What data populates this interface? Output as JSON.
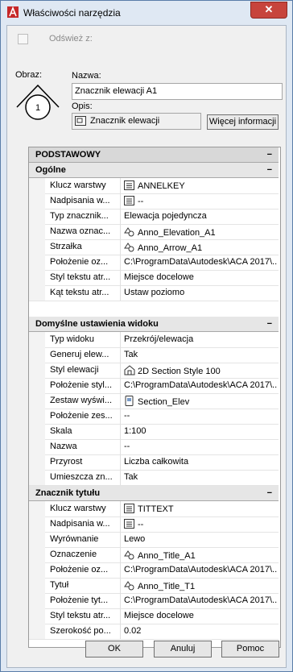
{
  "window": {
    "title": "Właściwości narzędzia",
    "close_glyph": "✕"
  },
  "top": {
    "refresh_label": "Odśwież z:",
    "image_label": "Obraz:",
    "name_label": "Nazwa:",
    "name_value": "Znacznik elewacji A1",
    "desc_label": "Opis:",
    "desc_value": "Znacznik elewacji",
    "more_button": "Więcej informacji",
    "symbol_number": "1"
  },
  "sections": {
    "basic": "PODSTAWOWY",
    "general": "Ogólne",
    "view_defaults": "Domyślne ustawienia widoku",
    "title_mark": "Znacznik tytułu",
    "collapse_glyph": "−"
  },
  "general_rows": [
    {
      "label": "Klucz warstwy",
      "value": "ANNELKEY",
      "icon": "layer-key-icon"
    },
    {
      "label": "Nadpisania w...",
      "value": "--",
      "icon": "layer-key-icon"
    },
    {
      "label": "Typ znacznik...",
      "value": "Elewacja pojedyncza",
      "icon": ""
    },
    {
      "label": "Nazwa oznac...",
      "value": "Anno_Elevation_A1",
      "icon": "block-icon"
    },
    {
      "label": "Strzałka",
      "value": "Anno_Arrow_A1",
      "icon": "block-icon"
    },
    {
      "label": "Położenie oz...",
      "value": "C:\\ProgramData\\Autodesk\\ACA 2017\\...",
      "icon": ""
    },
    {
      "label": "Styl tekstu atr...",
      "value": "Miejsce docelowe",
      "icon": ""
    },
    {
      "label": "Kąt tekstu atr...",
      "value": "Ustaw poziomo",
      "icon": ""
    }
  ],
  "view_rows": [
    {
      "label": "Typ widoku",
      "value": "Przekrój/elewacja",
      "icon": ""
    },
    {
      "label": "Generuj elew...",
      "value": "Tak",
      "icon": ""
    },
    {
      "label": "Styl elewacji",
      "value": "2D Section Style 100",
      "icon": "style-icon"
    },
    {
      "label": "Położenie styl...",
      "value": "C:\\ProgramData\\Autodesk\\ACA 2017\\...",
      "icon": ""
    },
    {
      "label": "Zestaw wyświ...",
      "value": "Section_Elev",
      "icon": "display-set-icon"
    },
    {
      "label": "Położenie zes...",
      "value": "--",
      "icon": ""
    },
    {
      "label": "Skala",
      "value": "1:100",
      "icon": ""
    },
    {
      "label": "Nazwa",
      "value": "--",
      "icon": ""
    },
    {
      "label": "Przyrost",
      "value": "Liczba całkowita",
      "icon": ""
    },
    {
      "label": "Umieszcza zn...",
      "value": "Tak",
      "icon": ""
    }
  ],
  "title_rows": [
    {
      "label": "Klucz warstwy",
      "value": "TITTEXT",
      "icon": "layer-key-icon"
    },
    {
      "label": "Nadpisania w...",
      "value": "--",
      "icon": "layer-key-icon"
    },
    {
      "label": "Wyrównanie",
      "value": "Lewo",
      "icon": ""
    },
    {
      "label": "Oznaczenie",
      "value": "Anno_Title_A1",
      "icon": "block-icon"
    },
    {
      "label": "Położenie oz...",
      "value": "C:\\ProgramData\\Autodesk\\ACA 2017\\...",
      "icon": ""
    },
    {
      "label": "Tytuł",
      "value": "Anno_Title_T1",
      "icon": "block-icon"
    },
    {
      "label": "Położenie tyt...",
      "value": "C:\\ProgramData\\Autodesk\\ACA 2017\\...",
      "icon": ""
    },
    {
      "label": "Styl tekstu atr...",
      "value": "Miejsce docelowe",
      "icon": ""
    },
    {
      "label": "Szerokość po...",
      "value": "0.02",
      "icon": ""
    }
  ],
  "buttons": {
    "ok": "OK",
    "cancel": "Anuluj",
    "help": "Pomoc"
  },
  "colors": {
    "accent": "#c7443c",
    "category_bg": "#d8d8d8"
  }
}
